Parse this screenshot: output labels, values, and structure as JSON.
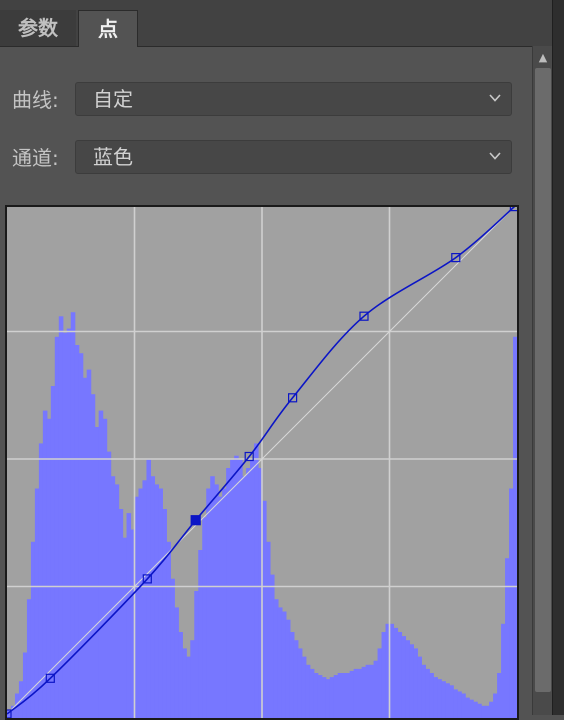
{
  "tabs": [
    {
      "label": "参数",
      "active": false
    },
    {
      "label": "点",
      "active": true
    }
  ],
  "curve_field": {
    "label": "曲线:",
    "value": "自定"
  },
  "channel_field": {
    "label": "通道:",
    "value": "蓝色"
  },
  "icons": {
    "dropdown": "chevron-down-icon",
    "scroll_up": "scroll-up-arrow-icon"
  },
  "colors": {
    "panel_bg": "#535353",
    "graph_bg": "#a1a1a1",
    "histogram": "#7777ff",
    "curve": "#0b15c6",
    "grid": "#d0d0d0"
  },
  "curve_points": [
    {
      "input": 0,
      "output": 0
    },
    {
      "input": 17,
      "output": 14
    },
    {
      "input": 55,
      "output": 53
    },
    {
      "input": 74,
      "output": 76
    },
    {
      "input": 95,
      "output": 101
    },
    {
      "input": 112,
      "output": 124
    },
    {
      "input": 140,
      "output": 156
    },
    {
      "input": 176,
      "output": 179
    },
    {
      "input": 199,
      "output": 199
    }
  ],
  "selected_point_index": 3,
  "histogram": [
    0.01,
    0.02,
    0.05,
    0.08,
    0.15,
    0.28,
    0.42,
    0.55,
    0.66,
    0.74,
    0.72,
    0.8,
    0.92,
    0.97,
    0.93,
    0.94,
    0.98,
    0.9,
    0.88,
    0.82,
    0.84,
    0.78,
    0.7,
    0.74,
    0.72,
    0.64,
    0.58,
    0.56,
    0.5,
    0.43,
    0.49,
    0.45,
    0.53,
    0.55,
    0.57,
    0.62,
    0.58,
    0.56,
    0.55,
    0.5,
    0.42,
    0.33,
    0.26,
    0.2,
    0.16,
    0.14,
    0.18,
    0.3,
    0.4,
    0.48,
    0.55,
    0.58,
    0.56,
    0.53,
    0.55,
    0.6,
    0.62,
    0.63,
    0.62,
    0.58,
    0.6,
    0.62,
    0.66,
    0.6,
    0.52,
    0.42,
    0.34,
    0.28,
    0.26,
    0.25,
    0.23,
    0.2,
    0.18,
    0.16,
    0.14,
    0.12,
    0.11,
    0.1,
    0.095,
    0.09,
    0.085,
    0.09,
    0.095,
    0.1,
    0.1,
    0.1,
    0.105,
    0.11,
    0.11,
    0.115,
    0.12,
    0.12,
    0.13,
    0.16,
    0.2,
    0.22,
    0.22,
    0.21,
    0.2,
    0.19,
    0.18,
    0.17,
    0.16,
    0.14,
    0.12,
    0.11,
    0.1,
    0.09,
    0.085,
    0.08,
    0.075,
    0.07,
    0.06,
    0.055,
    0.05,
    0.04,
    0.035,
    0.03,
    0.025,
    0.02,
    0.02,
    0.03,
    0.05,
    0.1,
    0.22,
    0.38,
    0.55,
    0.92
  ]
}
